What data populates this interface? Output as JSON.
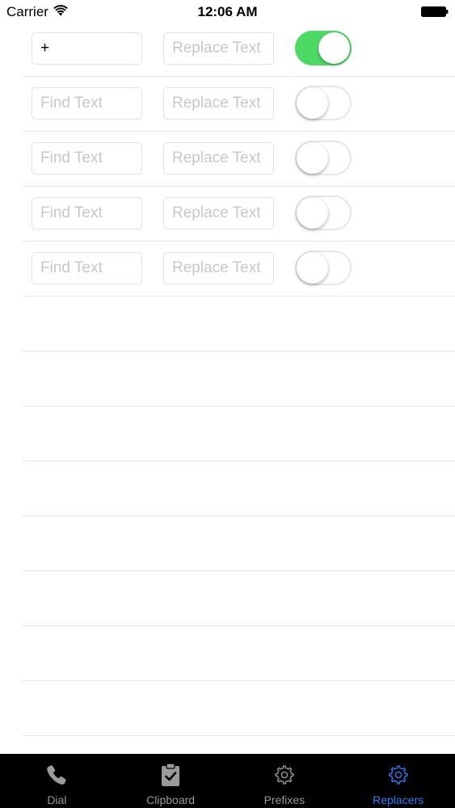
{
  "status_bar": {
    "carrier": "Carrier",
    "time": "12:06 AM"
  },
  "rows": [
    {
      "find_value": "+",
      "find_placeholder": "Find Text",
      "replace_value": "",
      "replace_placeholder": "Replace Text",
      "enabled": true
    },
    {
      "find_value": "",
      "find_placeholder": "Find Text",
      "replace_value": "",
      "replace_placeholder": "Replace Text",
      "enabled": false
    },
    {
      "find_value": "",
      "find_placeholder": "Find Text",
      "replace_value": "",
      "replace_placeholder": "Replace Text",
      "enabled": false
    },
    {
      "find_value": "",
      "find_placeholder": "Find Text",
      "replace_value": "",
      "replace_placeholder": "Replace Text",
      "enabled": false
    },
    {
      "find_value": "",
      "find_placeholder": "Find Text",
      "replace_value": "",
      "replace_placeholder": "Replace Text",
      "enabled": false
    }
  ],
  "tab_bar": {
    "tabs": [
      {
        "label": "Dial",
        "icon": "phone-icon",
        "active": false
      },
      {
        "label": "Clipboard",
        "icon": "clipboard-icon",
        "active": false
      },
      {
        "label": "Prefixes",
        "icon": "gear-icon",
        "active": false
      },
      {
        "label": "Replacers",
        "icon": "gear-icon",
        "active": true
      }
    ]
  },
  "colors": {
    "switch_on": "#4cd964",
    "tab_active": "#2f7cf6",
    "tab_inactive": "#9a9a9a",
    "tab_bar_bg": "#000000",
    "separator": "#e4e4e4",
    "placeholder": "#c7c7cd"
  }
}
